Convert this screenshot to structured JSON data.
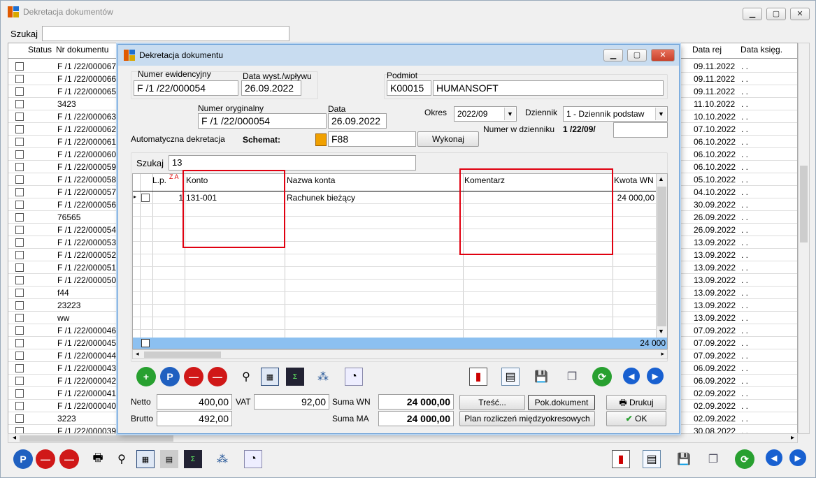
{
  "main": {
    "title": "Dekretacja dokumentów",
    "search_label": "Szukaj",
    "search_value": "",
    "columns": {
      "status": "Status",
      "nr": "Nr dokumentu",
      "data_rej": "Data rej",
      "data_ksieg": "Data księg."
    },
    "rows": [
      {
        "nr": "F /1  /22/000067",
        "data_rej": "09.11.2022",
        "data_ksieg": ". ."
      },
      {
        "nr": "F /1  /22/000066",
        "data_rej": "09.11.2022",
        "data_ksieg": ". ."
      },
      {
        "nr": "F /1  /22/000065",
        "data_rej": "09.11.2022",
        "data_ksieg": ". ."
      },
      {
        "nr": "3423",
        "data_rej": "11.10.2022",
        "data_ksieg": ". ."
      },
      {
        "nr": "F /1  /22/000063",
        "data_rej": "10.10.2022",
        "data_ksieg": ". ."
      },
      {
        "nr": "F /1  /22/000062",
        "data_rej": "07.10.2022",
        "data_ksieg": ". ."
      },
      {
        "nr": "F /1  /22/000061",
        "data_rej": "06.10.2022",
        "data_ksieg": ". ."
      },
      {
        "nr": "F /1  /22/000060",
        "data_rej": "06.10.2022",
        "data_ksieg": ". ."
      },
      {
        "nr": "F /1  /22/000059",
        "data_rej": "06.10.2022",
        "data_ksieg": ". ."
      },
      {
        "nr": "F /1  /22/000058",
        "data_rej": "05.10.2022",
        "data_ksieg": ". ."
      },
      {
        "nr": "F /1  /22/000057",
        "data_rej": "04.10.2022",
        "data_ksieg": ". ."
      },
      {
        "nr": "F /1  /22/000056",
        "data_rej": "30.09.2022",
        "data_ksieg": ". ."
      },
      {
        "nr": "76565",
        "data_rej": "26.09.2022",
        "data_ksieg": ". ."
      },
      {
        "nr": "F /1  /22/000054",
        "data_rej": "26.09.2022",
        "data_ksieg": ". ."
      },
      {
        "nr": "F /1  /22/000053",
        "data_rej": "13.09.2022",
        "data_ksieg": ". ."
      },
      {
        "nr": "F /1  /22/000052",
        "data_rej": "13.09.2022",
        "data_ksieg": ". ."
      },
      {
        "nr": "F /1  /22/000051",
        "data_rej": "13.09.2022",
        "data_ksieg": ". ."
      },
      {
        "nr": "F /1  /22/000050",
        "data_rej": "13.09.2022",
        "data_ksieg": ". ."
      },
      {
        "nr": "f44",
        "data_rej": "13.09.2022",
        "data_ksieg": ". ."
      },
      {
        "nr": "23223",
        "data_rej": "13.09.2022",
        "data_ksieg": ". ."
      },
      {
        "nr": "ww",
        "data_rej": "13.09.2022",
        "data_ksieg": ". ."
      },
      {
        "nr": "F /1  /22/000046",
        "data_rej": "07.09.2022",
        "data_ksieg": ". ."
      },
      {
        "nr": "F /1  /22/000045",
        "data_rej": "07.09.2022",
        "data_ksieg": ". ."
      },
      {
        "nr": "F /1  /22/000044",
        "data_rej": "07.09.2022",
        "data_ksieg": ". ."
      },
      {
        "nr": "F /1  /22/000043",
        "data_rej": "06.09.2022",
        "data_ksieg": ". ."
      },
      {
        "nr": "F /1  /22/000042",
        "data_rej": "06.09.2022",
        "data_ksieg": ". ."
      },
      {
        "nr": "F /1  /22/000041",
        "data_rej": "02.09.2022",
        "data_ksieg": ". ."
      },
      {
        "nr": "F /1  /22/000040",
        "data_rej": "02.09.2022",
        "data_ksieg": ". ."
      },
      {
        "nr": "3223",
        "data_rej": "02.09.2022",
        "data_ksieg": ". ."
      },
      {
        "nr": "F /1  /22/000039",
        "data_rej": "30.08.2022",
        "data_ksieg": ". ."
      }
    ]
  },
  "dialog": {
    "title": "Dekretacja dokumentu",
    "numer_ewid_label": "Numer ewidencyjny",
    "numer_ewid": "F /1  /22/000054",
    "data_wyst_label": "Data wyst./wpływu",
    "data_wyst": "26.09.2022",
    "podmiot_label": "Podmiot",
    "podmiot_kod": "K00015",
    "podmiot_nazwa": "HUMANSOFT",
    "numer_oryg_label": "Numer oryginalny",
    "numer_oryg": "F /1  /22/000054",
    "data_label": "Data",
    "data": "26.09.2022",
    "okres_label": "Okres",
    "okres": "2022/09",
    "dziennik_label": "Dziennik",
    "dziennik": "1  - Dziennik podstaw",
    "numer_dz_label": "Numer w dzienniku",
    "numer_dz": "1 /22/09/",
    "numer_dz_value": "",
    "auto_label": "Automatyczna dekretacja",
    "schemat_label": "Schemat:",
    "schemat": "F88",
    "wykonaj": "Wykonaj",
    "szukaj_label": "Szukaj",
    "szukaj": "13",
    "cols": {
      "lp": "L.p.",
      "konto": "Konto",
      "nazwa": "Nazwa konta",
      "komentarz": "Komentarz",
      "kwota": "Kwota WN"
    },
    "sort_marker": "Z A",
    "row": {
      "lp": "1",
      "konto": "131-001",
      "nazwa": "Rachunek bieżący",
      "komentarz": "",
      "kwota": "24 000,00"
    },
    "footer_kwota": "24 000",
    "netto_label": "Netto",
    "netto": "400,00",
    "vat_label": "VAT",
    "vat": "92,00",
    "brutto_label": "Brutto",
    "brutto": "492,00",
    "suma_wn_label": "Suma WN",
    "suma_wn": "24 000,00",
    "suma_ma_label": "Suma MA",
    "suma_ma": "24 000,00",
    "tresc": "Treść...",
    "pok_dokument": "Pok.dokument",
    "drukuj": "Drukuj",
    "plan": "Plan rozliczeń międzyokresowych",
    "ok": "OK"
  }
}
